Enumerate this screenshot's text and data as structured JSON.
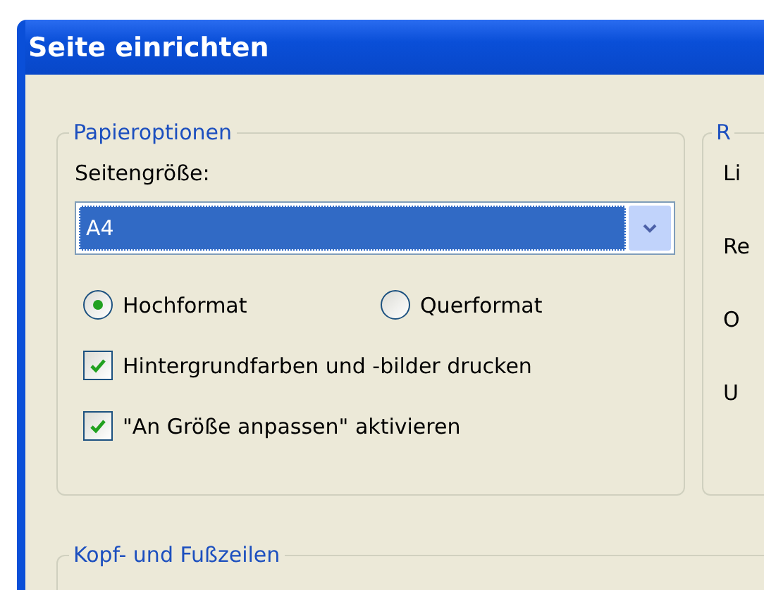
{
  "window": {
    "title": "Seite einrichten"
  },
  "paper_options": {
    "title": "Papieroptionen",
    "page_size_label": "Seitengröße:",
    "page_size": {
      "value": "A4"
    },
    "orientation": [
      {
        "label": "Hochformat",
        "selected": true
      },
      {
        "label": "Querformat",
        "selected": false
      }
    ],
    "checkboxes": [
      {
        "label": "Hintergrundfarben und -bilder drucken",
        "checked": true
      },
      {
        "label": "\"An Größe anpassen\" aktivieren",
        "checked": true
      }
    ]
  },
  "group_2": {
    "title": "R",
    "labels": [
      "Li",
      "Re",
      "O",
      "U"
    ]
  },
  "headers_footers": {
    "title": "Kopf- und Fußzeilen"
  }
}
